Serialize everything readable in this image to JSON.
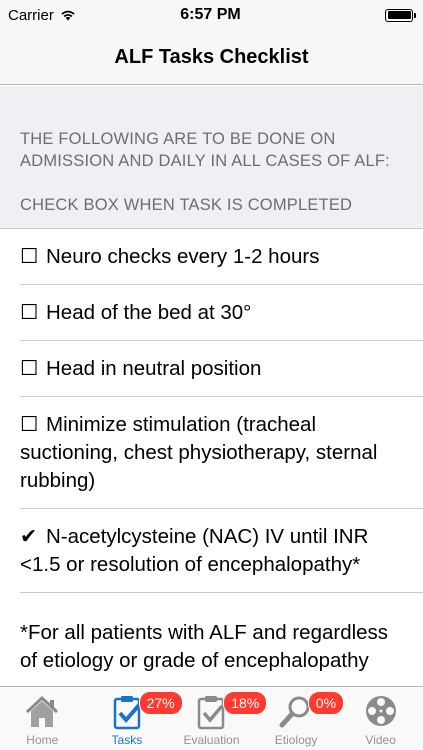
{
  "status_bar": {
    "carrier": "Carrier",
    "time": "6:57 PM"
  },
  "nav": {
    "title": "ALF Tasks Checklist"
  },
  "section": {
    "line1": "THE FOLLOWING ARE TO BE DONE ON ADMISSION AND DAILY IN ALL CASES OF ALF:",
    "line2": "CHECK BOX WHEN TASK IS COMPLETED"
  },
  "tasks": [
    {
      "check": "☐",
      "text": "Neuro checks every 1-2 hours"
    },
    {
      "check": "☐",
      "text": "Head of the bed at 30°"
    },
    {
      "check": "☐",
      "text": "Head in neutral position"
    },
    {
      "check": "☐",
      "text": "Minimize stimulation (tracheal suctioning, chest physiotherapy, sternal rubbing)"
    },
    {
      "check": "✔",
      "text": "N-acetylcysteine (NAC) IV until INR <1.5 or resolution of encephalopathy*"
    },
    {
      "check": "",
      "text": "*For all patients with ALF and regardless of etiology or grade of encephalopathy"
    }
  ],
  "tabs": [
    {
      "label": "Home",
      "icon": "home-icon"
    },
    {
      "label": "Tasks",
      "icon": "clipboard-check-icon",
      "badge": "27%"
    },
    {
      "label": "Evaluation",
      "icon": "clipboard-icon",
      "badge": "18%"
    },
    {
      "label": "Etiology",
      "icon": "magnifier-icon",
      "badge": "0%"
    },
    {
      "label": "Video",
      "icon": "film-reel-icon"
    }
  ],
  "colors": {
    "accent": "#1a73c9",
    "badge": "#ff3b30",
    "header_text": "#6d6d72",
    "group_background": "#efeff4"
  }
}
